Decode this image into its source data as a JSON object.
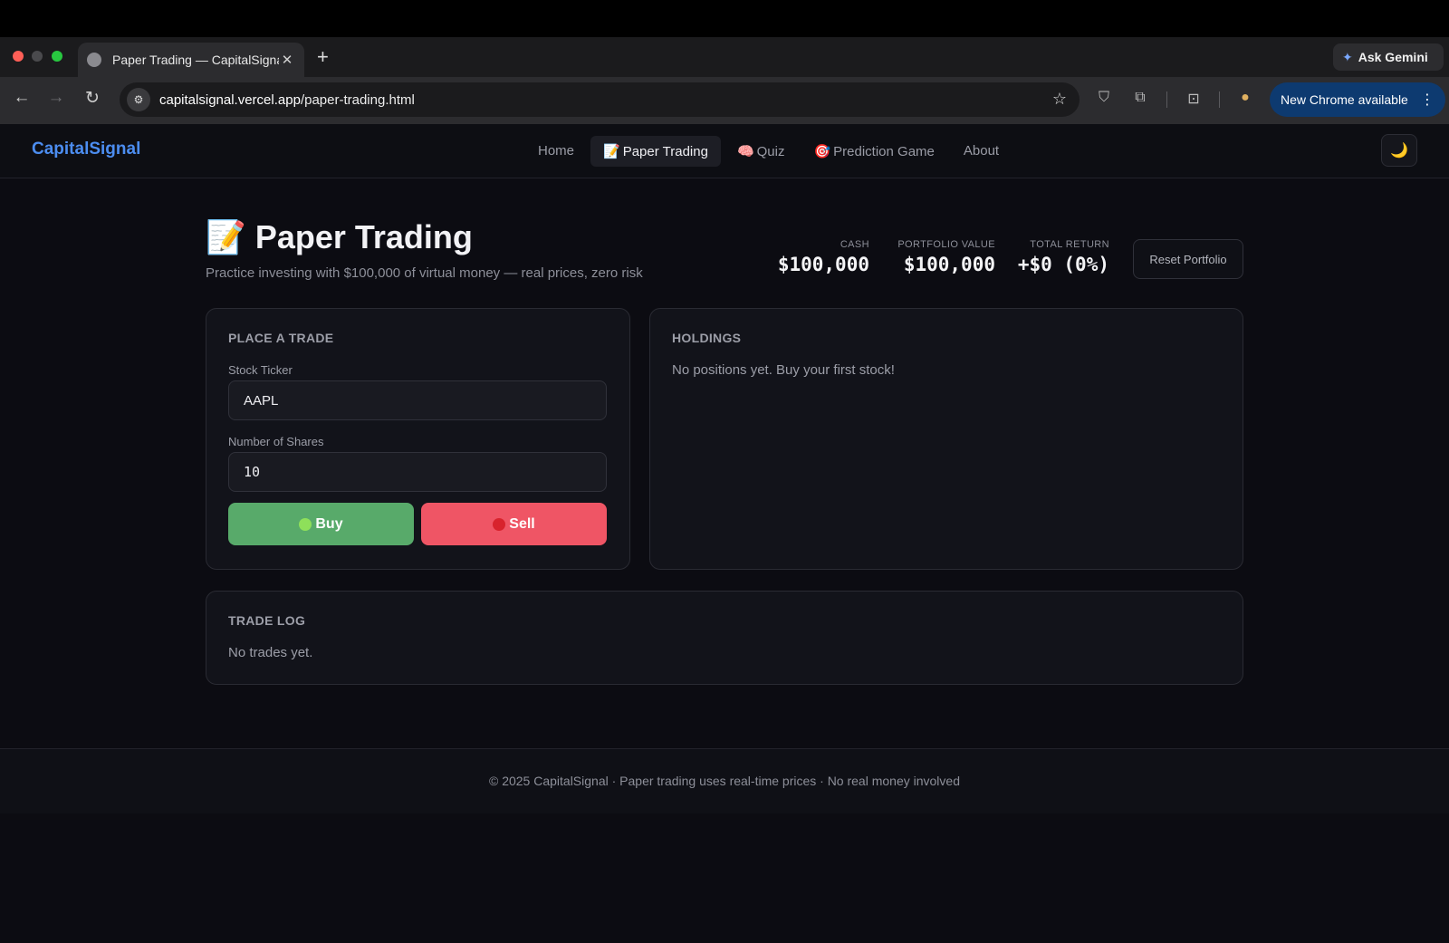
{
  "browser": {
    "tab_title": "Paper Trading — CapitalSignal",
    "tab_close": "✕",
    "new_tab": "+",
    "ask_gemini": "Ask Gemini",
    "url_host": "capitalsignal.vercel.app",
    "url_path": "/paper-trading.html",
    "new_chrome": "New Chrome available",
    "traffic_colors": [
      "#ff5f57",
      "#4a4a4d",
      "#28c840"
    ]
  },
  "nav": {
    "brand": "CapitalSignal",
    "links": [
      {
        "label": "Home",
        "icon": ""
      },
      {
        "label": "Paper Trading",
        "icon": "📝"
      },
      {
        "label": "Quiz",
        "icon": "🧠"
      },
      {
        "label": "Prediction Game",
        "icon": "🎯"
      },
      {
        "label": "About",
        "icon": ""
      }
    ],
    "active_index": 1,
    "theme_icon": "🌙"
  },
  "header": {
    "icon": "📝",
    "title": "Paper Trading",
    "subtitle": "Practice investing with $100,000 of virtual money — real prices, zero risk"
  },
  "stats": [
    {
      "label": "CASH",
      "value": "$100,000"
    },
    {
      "label": "PORTFOLIO VALUE",
      "value": "$100,000"
    },
    {
      "label": "TOTAL RETURN",
      "value": "+$0 (0%)"
    }
  ],
  "reset_label": "Reset Portfolio",
  "trade": {
    "title": "PLACE A TRADE",
    "ticker_label": "Stock Ticker",
    "ticker_value": "AAPL",
    "shares_label": "Number of Shares",
    "shares_value": "10",
    "buy_label": "Buy",
    "sell_label": "Sell",
    "buy_color": "#58aa6a",
    "sell_color": "#ef5565"
  },
  "holdings": {
    "title": "HOLDINGS",
    "empty": "No positions yet. Buy your first stock!"
  },
  "trade_log": {
    "title": "TRADE LOG",
    "empty": "No trades yet."
  },
  "footer": "© 2025 CapitalSignal · Paper trading uses real-time prices · No real money involved"
}
